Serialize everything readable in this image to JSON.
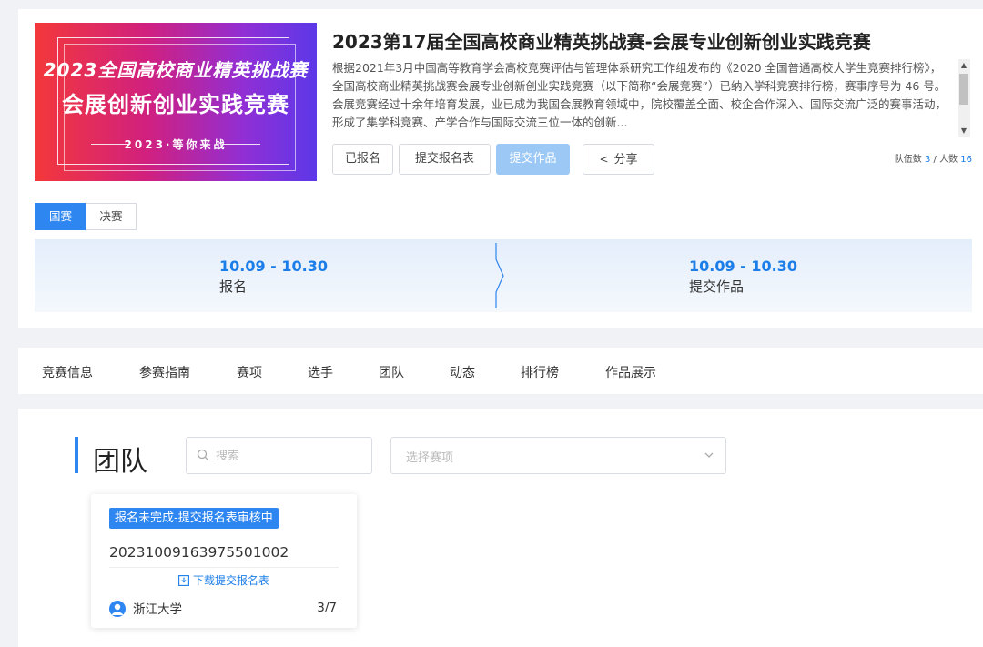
{
  "banner": {
    "line1": "2023全国高校商业精英挑战赛",
    "line2": "会展创新创业实践竞赛",
    "line3": "2023·等你来战"
  },
  "competition": {
    "title": "2023第17届全国高校商业精英挑战赛-会展专业创新创业实践竞赛",
    "description": "根据2021年3月中国高等教育学会高校竞赛评估与管理体系研究工作组发布的《2020 全国普通高校大学生竞赛排行榜》，全国高校商业精英挑战赛会展专业创新创业实践竞赛（以下简称“会展竞赛”）已纳入学科竞赛排行榜，赛事序号为 46 号。会展竞赛经过十余年培育发展，业已成为我国会展教育领域中，院校覆盖全面、校企合作深入、国际交流广泛的赛事活动，形成了集学科竞赛、产学合作与国际交流三位一体的创新..."
  },
  "actions": {
    "registered": "已报名",
    "submit_form": "提交报名表",
    "submit_work": "提交作品",
    "share": "分享"
  },
  "stats": {
    "teams_label": "队伍数",
    "teams_value": "3",
    "separator": "/",
    "people_label": "人数",
    "people_value": "16"
  },
  "stages": [
    "国赛",
    "决赛"
  ],
  "timeline": [
    {
      "date": "10.09 - 10.30",
      "label": "报名"
    },
    {
      "date": "10.09 - 10.30",
      "label": "提交作品"
    }
  ],
  "tabs": [
    "竞赛信息",
    "参赛指南",
    "赛项",
    "选手",
    "团队",
    "动态",
    "排行榜",
    "作品展示"
  ],
  "section": {
    "title": "团队",
    "search_placeholder": "搜索",
    "select_placeholder": "选择赛项"
  },
  "team": {
    "status": "报名未完成-提交报名表审核中",
    "id": "20231009163975501002",
    "download": "下载提交报名表",
    "school": "浙江大学",
    "count": "3/7"
  },
  "colors": {
    "primary": "#2e86f0",
    "link": "#1a7de8",
    "disabled": "#9cc8f6"
  }
}
